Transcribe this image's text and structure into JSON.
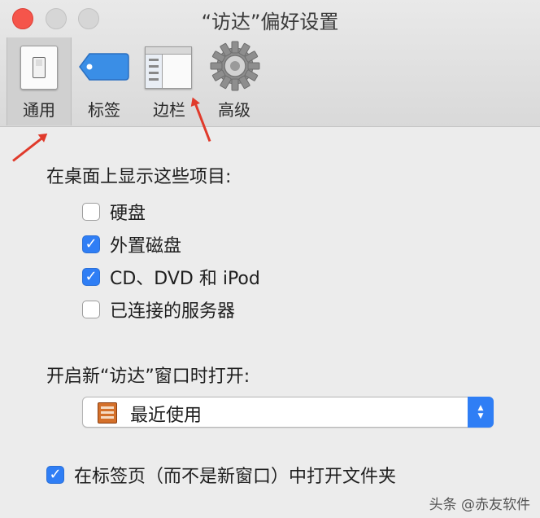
{
  "window": {
    "title": "“访达”偏好设置"
  },
  "tabs": [
    {
      "id": "general",
      "label": "通用",
      "icon": "light-switch-icon",
      "selected": true
    },
    {
      "id": "tags",
      "label": "标签",
      "icon": "tag-icon",
      "selected": false
    },
    {
      "id": "sidebar",
      "label": "边栏",
      "icon": "sidebar-window-icon",
      "selected": false
    },
    {
      "id": "advanced",
      "label": "高级",
      "icon": "gear-icon",
      "selected": false
    }
  ],
  "desktop": {
    "heading": "在桌面上显示这些项目:",
    "items": [
      {
        "label": "硬盘",
        "checked": false
      },
      {
        "label": "外置磁盘",
        "checked": true
      },
      {
        "label": "CD、DVD 和 iPod",
        "checked": true
      },
      {
        "label": "已连接的服务器",
        "checked": false
      }
    ]
  },
  "new_window": {
    "heading": "开启新“访达”窗口时打开:",
    "selected": "最近使用",
    "icon": "recents-book-icon"
  },
  "tabs_option": {
    "label": "在标签页（而不是新窗口）中打开文件夹",
    "checked": true
  },
  "colors": {
    "accent": "#2f7ef5",
    "arrow": "#e03a2b",
    "close": "#f5554b"
  },
  "watermark": "头条 @赤友软件"
}
